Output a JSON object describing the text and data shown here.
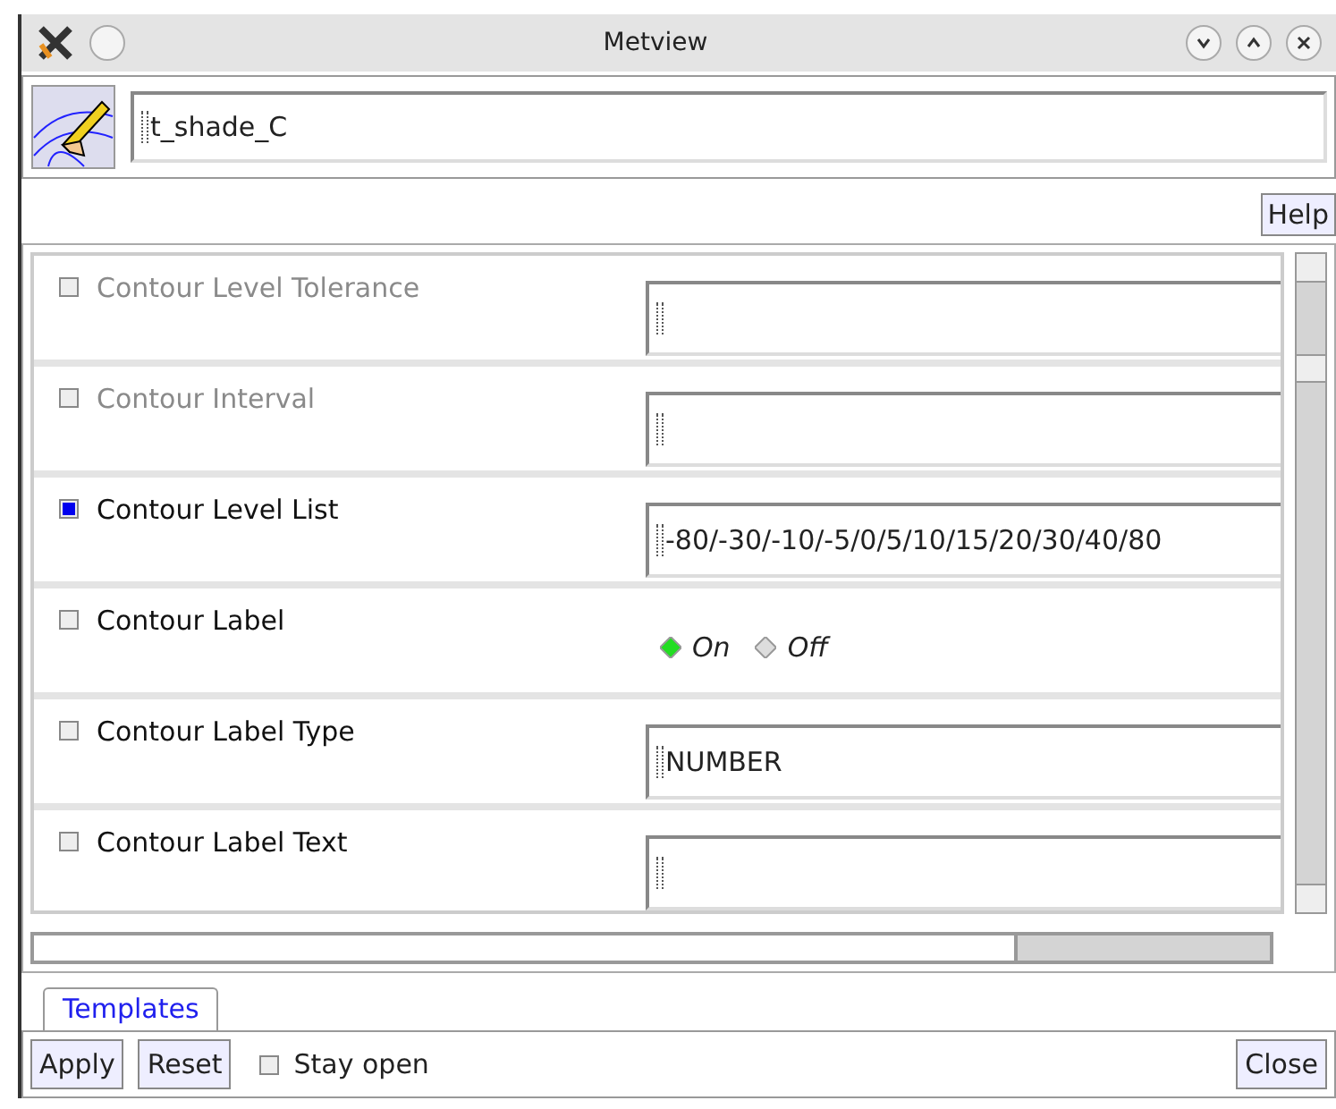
{
  "window": {
    "title": "Metview"
  },
  "icon_name": "t_shade_C",
  "help_button": "Help",
  "parameters": [
    {
      "kind": "text",
      "label": "Contour Level Tolerance",
      "checked": false,
      "disabled": true
    },
    {
      "kind": "text",
      "label": "Contour Interval",
      "checked": false,
      "disabled": true
    },
    {
      "kind": "text",
      "label": "Contour Level List",
      "checked": true,
      "disabled": false,
      "value": "-80/-30/-10/-5/0/5/10/15/20/30/40/80"
    },
    {
      "kind": "radio",
      "label": "Contour Label",
      "checked": false,
      "disabled": false,
      "options": [
        {
          "label": "On",
          "selected": true
        },
        {
          "label": "Off",
          "selected": false
        }
      ]
    },
    {
      "kind": "text",
      "label": "Contour Label Type",
      "checked": false,
      "disabled": false,
      "value": "NUMBER"
    },
    {
      "kind": "text",
      "label": "Contour Label Text",
      "checked": false,
      "disabled": false
    }
  ],
  "tabs": [
    {
      "label": "Templates",
      "selected": true
    }
  ],
  "buttons": {
    "apply": "Apply",
    "reset": "Reset",
    "close": "Close"
  },
  "stay_open": {
    "label": "Stay open",
    "checked": false
  }
}
